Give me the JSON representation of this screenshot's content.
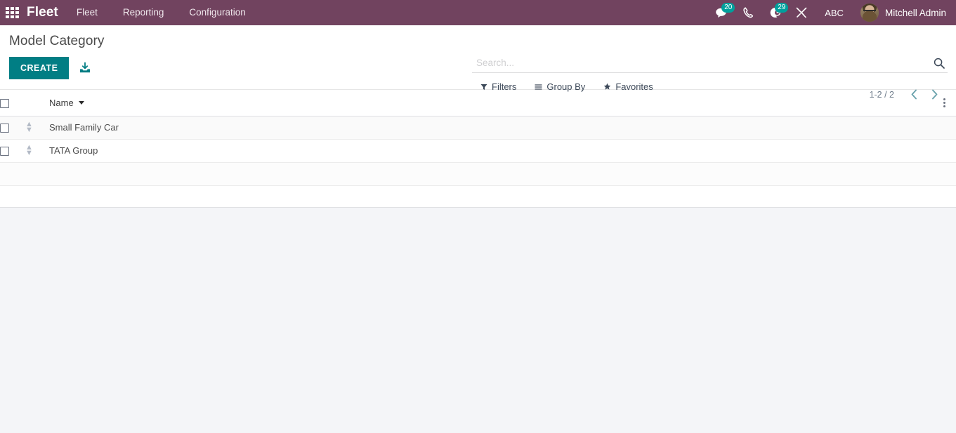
{
  "navbar": {
    "apps_icon": "apps-grid-icon",
    "brand": "Fleet",
    "menus": [
      {
        "label": "Fleet"
      },
      {
        "label": "Reporting"
      },
      {
        "label": "Configuration"
      }
    ],
    "messages_icon": "messages-icon",
    "messages_count": "20",
    "phone_icon": "phone-icon",
    "activities_icon": "activities-clock-icon",
    "activities_count": "29",
    "tools_icon": "wrench-screwdriver-icon",
    "debug_label": "ABC",
    "avatar_icon": "user-avatar",
    "user_name": "Mitchell Admin",
    "badge_color": "#00a09d",
    "background_color": "#71435f"
  },
  "control_panel": {
    "title": "Model Category",
    "create_label": "CREATE",
    "create_color": "#017e84",
    "import_icon": "import-download-icon",
    "search": {
      "placeholder": "Search...",
      "value": "",
      "search_icon": "search-icon"
    },
    "filter_buttons": [
      {
        "label": "Filters",
        "icon": "filter-funnel-icon"
      },
      {
        "label": "Group By",
        "icon": "group-by-lines-icon"
      },
      {
        "label": "Favorites",
        "icon": "favorites-star-icon"
      }
    ],
    "pager": {
      "value": "1-2 / 2",
      "prev_icon": "chevron-left-icon",
      "next_icon": "chevron-right-icon"
    }
  },
  "list": {
    "select_all_checkbox": "unchecked",
    "columns": [
      {
        "label": "Name",
        "sort": "desc",
        "sort_icon": "caret-down-icon"
      }
    ],
    "optional_columns_icon": "kebab-menu-icon",
    "row_handle_icon": "drag-handle-icon",
    "rows": [
      {
        "checkbox": "unchecked",
        "name": "Small Family Car"
      },
      {
        "checkbox": "unchecked",
        "name": "TATA Group"
      }
    ]
  }
}
